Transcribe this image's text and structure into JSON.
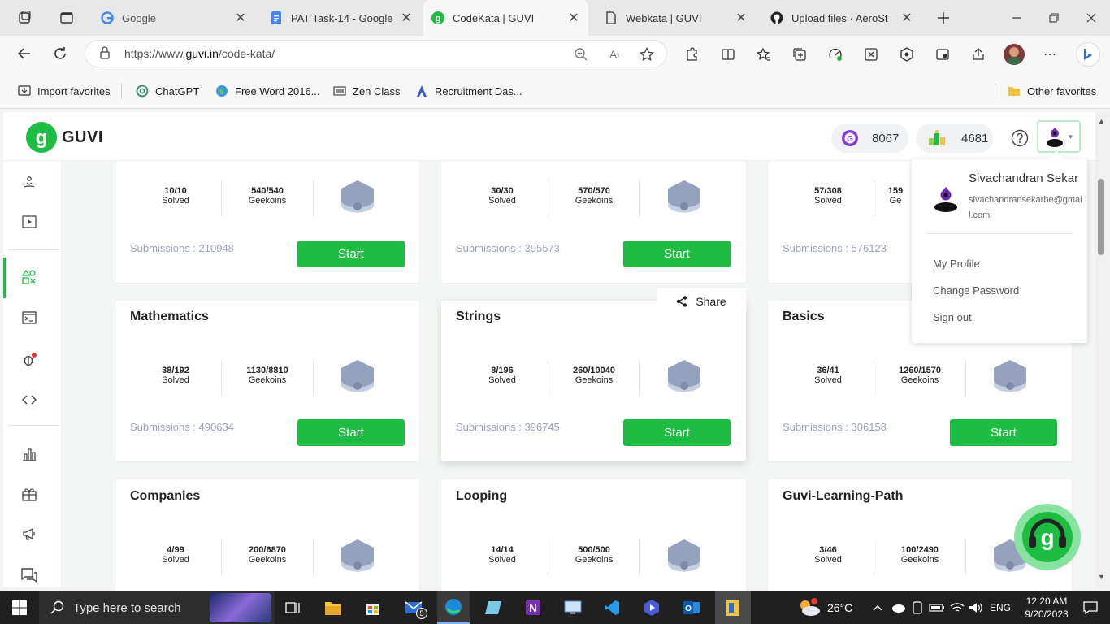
{
  "browser": {
    "tabs": [
      {
        "label": "Google",
        "active": false
      },
      {
        "label": "PAT Task-14 - Google",
        "active": false
      },
      {
        "label": "CodeKata | GUVI",
        "active": true
      },
      {
        "label": "Webkata | GUVI",
        "active": false
      },
      {
        "label": "Upload files · AeroSt",
        "active": false
      }
    ],
    "url_prefix": "https://www.",
    "url_domain": "guvi.in",
    "url_path": "/code-kata/",
    "favorites": [
      "Import favorites",
      "ChatGPT",
      "Free Word 2016...",
      "Zen Class",
      "Recruitment Das..."
    ],
    "other_favorites": "Other favorites"
  },
  "header": {
    "logo_text": "GUVI",
    "geekoins": "8067",
    "rank": "4681",
    "brand_color": "#1dbc43"
  },
  "cards": [
    {
      "title": "",
      "solved": "10/10",
      "solved_label": "Solved",
      "geekoins": "540/540",
      "geekoins_label": "Geekoins",
      "submissions": "Submissions : 210948",
      "button": "Start"
    },
    {
      "title": "",
      "solved": "30/30",
      "solved_label": "Solved",
      "geekoins": "570/570",
      "geekoins_label": "Geekoins",
      "submissions": "Submissions : 395573",
      "button": "Start"
    },
    {
      "title": "",
      "solved": "57/308",
      "solved_label": "Solved",
      "geekoins": "159",
      "geekoins_label": "Ge",
      "submissions": "Submissions : 576123",
      "button": "Start"
    },
    {
      "title": "Mathematics",
      "solved": "38/192",
      "solved_label": "Solved",
      "geekoins": "1130/8810",
      "geekoins_label": "Geekoins",
      "submissions": "Submissions : 490634",
      "button": "Start"
    },
    {
      "title": "Strings",
      "solved": "8/196",
      "solved_label": "Solved",
      "geekoins": "260/10040",
      "geekoins_label": "Geekoins",
      "submissions": "Submissions : 396745",
      "button": "Start",
      "share": "Share"
    },
    {
      "title": "Basics",
      "solved": "36/41",
      "solved_label": "Solved",
      "geekoins": "1260/1570",
      "geekoins_label": "Geekoins",
      "submissions": "Submissions : 306158",
      "button": "Start"
    },
    {
      "title": "Companies",
      "solved": "4/99",
      "solved_label": "Solved",
      "geekoins": "200/6870",
      "geekoins_label": "Geekoins"
    },
    {
      "title": "Looping",
      "solved": "14/14",
      "solved_label": "Solved",
      "geekoins": "500/500",
      "geekoins_label": "Geekoins"
    },
    {
      "title": "Guvi-Learning-Path",
      "solved": "3/46",
      "solved_label": "Solved",
      "geekoins": "100/2490",
      "geekoins_label": "Geekoins"
    }
  ],
  "profile_menu": {
    "name": "Sivachandran Sekar",
    "email_line1": "sivachandransekarbe@gmai",
    "email_line2": "l.com",
    "items": [
      "My Profile",
      "Change Password",
      "Sign out"
    ]
  },
  "taskbar": {
    "search_placeholder": "Type here to search",
    "mail_badge": "5",
    "weather": "26°C",
    "language": "ENG",
    "time": "12:20 AM",
    "date": "9/20/2023"
  }
}
